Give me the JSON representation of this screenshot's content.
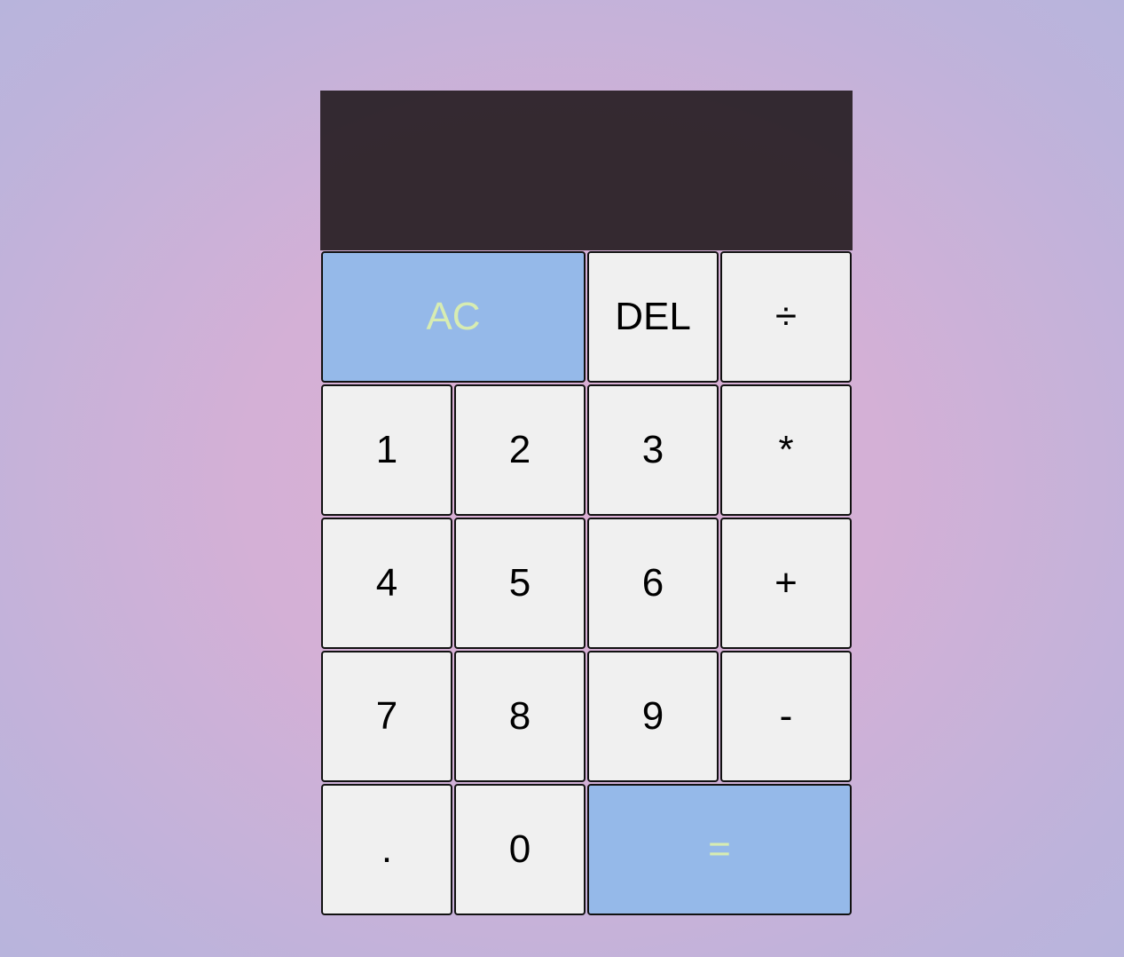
{
  "display": {
    "previous_operand": "",
    "current_operand": ""
  },
  "buttons": {
    "all_clear": "AC",
    "delete": "DEL",
    "divide": "÷",
    "one": "1",
    "two": "2",
    "three": "3",
    "multiply": "*",
    "four": "4",
    "five": "5",
    "six": "6",
    "add": "+",
    "seven": "7",
    "eight": "8",
    "nine": "9",
    "subtract": "-",
    "decimal": ".",
    "zero": "0",
    "equals": "="
  },
  "colors": {
    "display_background": "#2a1f25",
    "button_background": "#f0f0f0",
    "accent_button_background": "#95b9e9",
    "accent_button_text": "#d7ecb2",
    "page_gradient_center": "#dbaed2",
    "page_gradient_edge": "#b8b4dc"
  }
}
